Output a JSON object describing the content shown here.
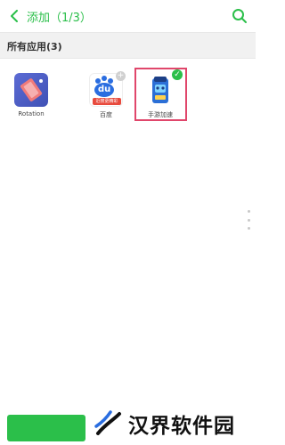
{
  "header": {
    "title": "添加（1/3）"
  },
  "section": {
    "label": "所有应用(3)"
  },
  "apps": [
    {
      "label": "Rotation",
      "icon": "rotation-app-icon"
    },
    {
      "label": "百度",
      "icon": "baidu-app-icon",
      "icon_text": "du",
      "icon_banner": "近搜更精彩"
    },
    {
      "label": "手游加速",
      "icon": "game-booster-app-icon",
      "selected": true
    }
  ],
  "colors": {
    "accent": "#2bbf4a",
    "selection_frame": "#e0466b"
  },
  "watermark": {
    "text": "汉界软件园"
  }
}
